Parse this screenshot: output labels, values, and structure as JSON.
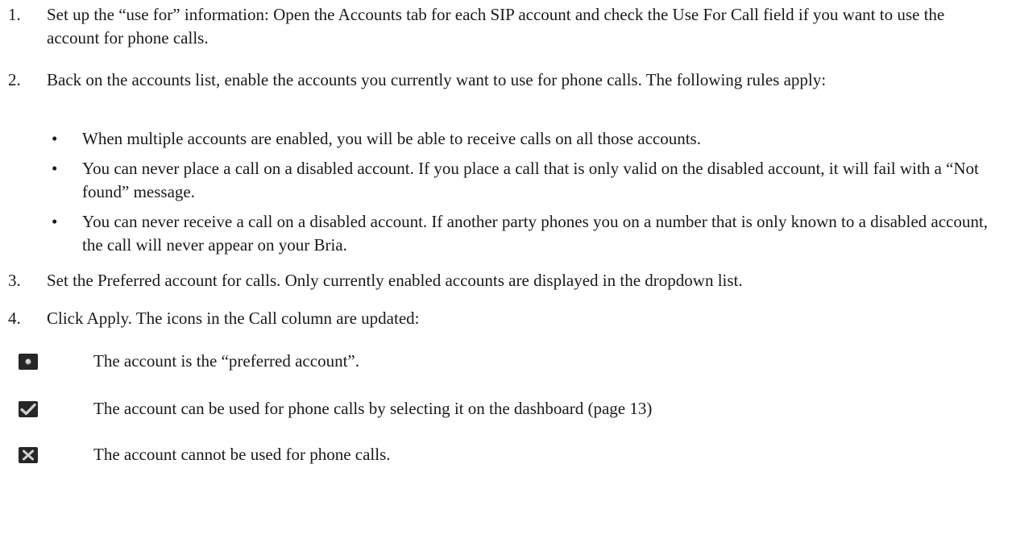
{
  "steps": [
    {
      "number": "1.",
      "text": "Set up the “use for” information: Open the Accounts tab for each SIP account and check the Use For Call field if you want to use the account for phone calls."
    },
    {
      "number": "2.",
      "text": "Back on the accounts list, enable the accounts you currently want to use for phone calls. The following rules apply:"
    },
    {
      "number": "3.",
      "text": "Set the Preferred account for calls. Only currently enabled accounts are displayed in the dropdown list."
    },
    {
      "number": "4.",
      "text": "Click Apply. The icons in the Call column are updated:"
    }
  ],
  "rules": [
    {
      "mark": "•",
      "text": "When multiple accounts are enabled, you will be able to receive calls on all those accounts."
    },
    {
      "mark": "•",
      "text": "You can never place a call on a disabled account. If you place a call that is only valid on the disabled account, it will fail with a “Not found” message."
    },
    {
      "mark": "•",
      "text": "You can never receive a call on a disabled account. If another party phones you on a number that is only known to a disabled account, the call will never appear on your Bria."
    }
  ],
  "call_icons": [
    {
      "icon": "preferred-dot-icon",
      "text": "The account is the “preferred account”."
    },
    {
      "icon": "checkmark-icon",
      "text": "The account can be used for phone calls by selecting it on the dashboard (page 13)"
    },
    {
      "icon": "cross-icon",
      "text": "The account cannot be used for phone calls."
    }
  ],
  "colors": {
    "text": "#1a1a1a",
    "icon_background": "#262626",
    "icon_symbol": "#cfcfcf"
  }
}
